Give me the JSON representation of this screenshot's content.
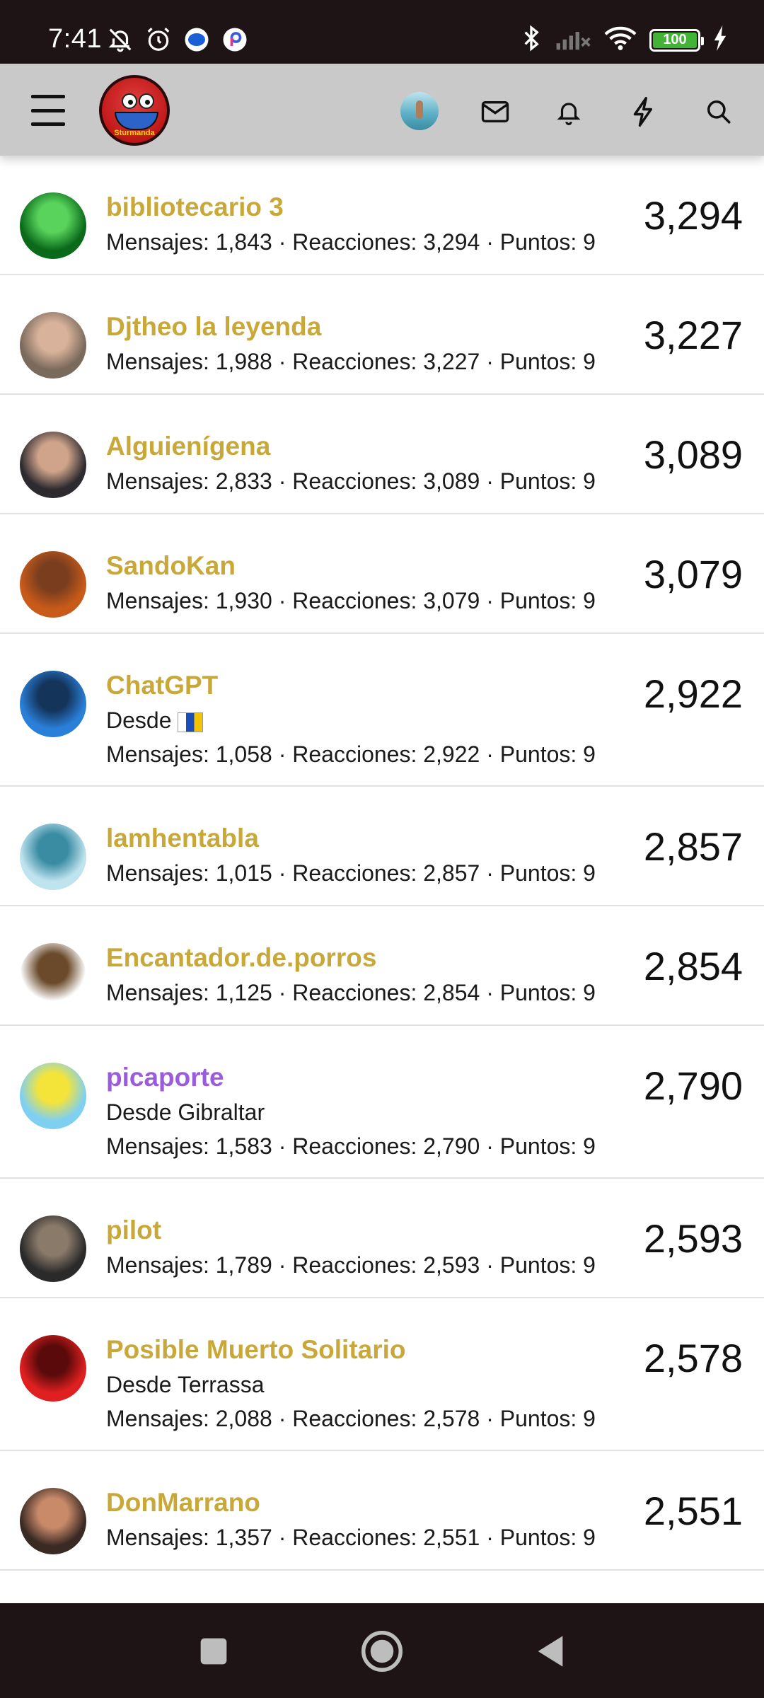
{
  "status_bar": {
    "time": "7:41",
    "battery": "100",
    "icons": [
      "mute-bell-icon",
      "alarm-icon",
      "message-app-icon",
      "app-icon",
      "bluetooth-icon",
      "signal-icon",
      "wifi-icon",
      "battery-icon",
      "charging-icon"
    ]
  },
  "header": {
    "logo_text": "Sturmanda",
    "icons": [
      "menu-icon",
      "mail-icon",
      "bell-icon",
      "lightning-icon",
      "search-icon"
    ]
  },
  "members": [
    {
      "name": "bibliotecario 3",
      "location": "",
      "stats": "Mensajes: 1,843 · Reacciones: 3,294 · Puntos: 9",
      "score": "3,294",
      "name_color": "#c9a83a",
      "avatar_colors": [
        "#0a6a1a",
        "#59d35c"
      ]
    },
    {
      "name": "Djtheo la leyenda",
      "location": "",
      "stats": "Mensajes: 1,988 · Reacciones: 3,227 · Puntos: 9",
      "score": "3,227",
      "name_color": "#c9a83a",
      "avatar_colors": [
        "#7a6a5c",
        "#d8b29a"
      ]
    },
    {
      "name": "Alguienígena",
      "location": "",
      "stats": "Mensajes: 2,833 · Reacciones: 3,089 · Puntos: 9",
      "score": "3,089",
      "name_color": "#c9a83a",
      "avatar_colors": [
        "#2e2b30",
        "#cfa48a"
      ]
    },
    {
      "name": "SandoKan",
      "location": "",
      "stats": "Mensajes: 1,930 · Reacciones: 3,079 · Puntos: 9",
      "score": "3,079",
      "name_color": "#c9a83a",
      "avatar_colors": [
        "#c85a1a",
        "#7a3e1e"
      ]
    },
    {
      "name": "ChatGPT",
      "location": "Desde",
      "stats": "Mensajes: 1,058 · Reacciones: 2,922 · Puntos: 9",
      "score": "2,922",
      "name_color": "#c9a83a",
      "avatar_colors": [
        "#2a7fd8",
        "#14345a"
      ],
      "flag": true
    },
    {
      "name": "lamhentabla",
      "location": "",
      "stats": "Mensajes: 1,015 · Reacciones: 2,857 · Puntos: 9",
      "score": "2,857",
      "name_color": "#c9a83a",
      "avatar_colors": [
        "#bfe3ef",
        "#3a8ca3"
      ]
    },
    {
      "name": "Encantador.de.porros",
      "location": "",
      "stats": "Mensajes: 1,125 · Reacciones: 2,854 · Puntos: 9",
      "score": "2,854",
      "name_color": "#c9a83a",
      "avatar_colors": [
        "#ffffff",
        "#6a4a2a"
      ]
    },
    {
      "name": "picaporte",
      "location": "Desde Gibraltar",
      "stats": "Mensajes: 1,583 · Reacciones: 2,790 · Puntos: 9",
      "score": "2,790",
      "name_color": "#9a5cdc",
      "avatar_colors": [
        "#7fd0f0",
        "#f4e43a"
      ]
    },
    {
      "name": "pilot",
      "location": "",
      "stats": "Mensajes: 1,789 · Reacciones: 2,593 · Puntos: 9",
      "score": "2,593",
      "name_color": "#c9a83a",
      "avatar_colors": [
        "#2a2a2a",
        "#8a7a6a"
      ]
    },
    {
      "name": "Posible Muerto Solitario",
      "location": "Desde Terrassa",
      "stats": "Mensajes: 2,088 · Reacciones: 2,578 · Puntos: 9",
      "score": "2,578",
      "name_color": "#c9a83a",
      "avatar_colors": [
        "#e02020",
        "#5a0a0a"
      ]
    },
    {
      "name": "DonMarrano",
      "location": "",
      "stats": "Mensajes: 1,357 · Reacciones: 2,551 · Puntos: 9",
      "score": "2,551",
      "name_color": "#c9a83a",
      "avatar_colors": [
        "#3a2a24",
        "#c98a6a"
      ]
    }
  ],
  "nav_bar": {
    "icons": [
      "recent-apps-icon",
      "home-icon",
      "back-icon"
    ]
  }
}
